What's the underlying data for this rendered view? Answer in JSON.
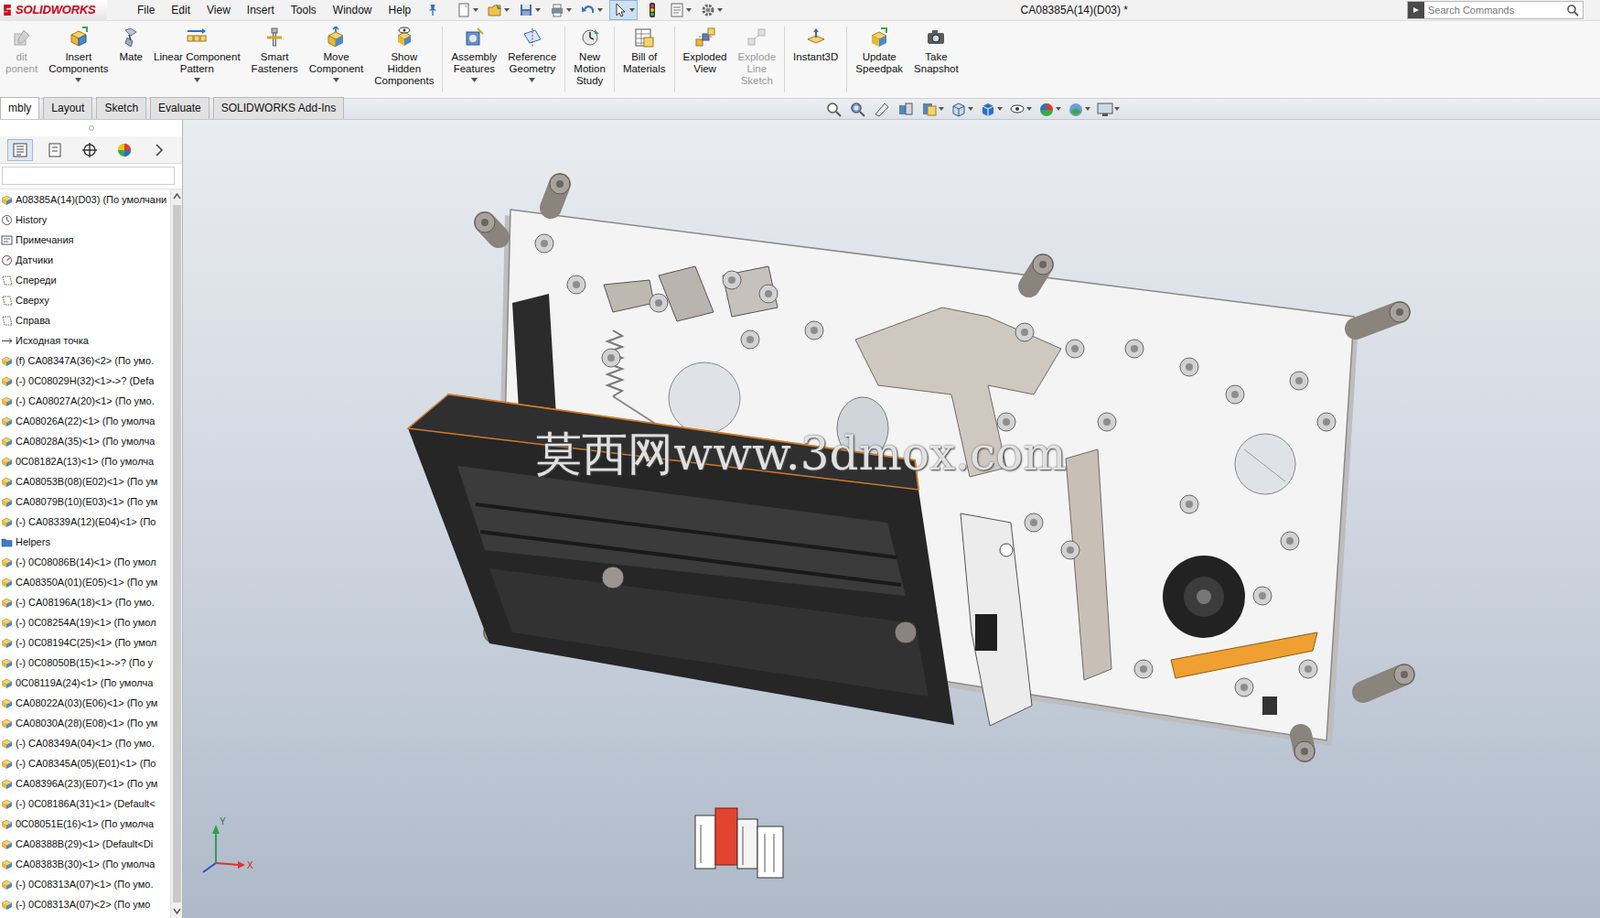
{
  "app": {
    "logo": "SOLIDWORKS",
    "title": "CA08385A(14)(D03) *"
  },
  "menu": [
    "File",
    "Edit",
    "View",
    "Insert",
    "Tools",
    "Window",
    "Help"
  ],
  "search": {
    "placeholder": "Search Commands"
  },
  "ribbon": [
    {
      "buttons": [
        {
          "label": "dit\nponent",
          "disabled": true,
          "dropdown": false
        },
        {
          "label": "Insert\nComponents",
          "disabled": false,
          "dropdown": true
        },
        {
          "label": "Mate",
          "disabled": false,
          "dropdown": false
        },
        {
          "label": "Linear Component\nPattern",
          "disabled": false,
          "dropdown": true
        },
        {
          "label": "Smart\nFasteners",
          "disabled": false,
          "dropdown": false
        },
        {
          "label": "Move\nComponent",
          "disabled": false,
          "dropdown": true
        },
        {
          "label": "Show\nHidden\nComponents",
          "disabled": false,
          "dropdown": false
        }
      ]
    },
    {
      "buttons": [
        {
          "label": "Assembly\nFeatures",
          "disabled": false,
          "dropdown": true
        },
        {
          "label": "Reference\nGeometry",
          "disabled": false,
          "dropdown": true
        }
      ]
    },
    {
      "buttons": [
        {
          "label": "New\nMotion\nStudy",
          "disabled": false,
          "dropdown": false
        }
      ]
    },
    {
      "buttons": [
        {
          "label": "Bill of\nMaterials",
          "disabled": false,
          "dropdown": false
        }
      ]
    },
    {
      "buttons": [
        {
          "label": "Exploded\nView",
          "disabled": false,
          "dropdown": false
        },
        {
          "label": "Explode\nLine\nSketch",
          "disabled": true,
          "dropdown": false
        }
      ]
    },
    {
      "buttons": [
        {
          "label": "Instant3D",
          "disabled": false,
          "dropdown": false
        }
      ]
    },
    {
      "buttons": [
        {
          "label": "Update\nSpeedpak",
          "disabled": false,
          "dropdown": false
        },
        {
          "label": "Take\nSnapshot",
          "disabled": false,
          "dropdown": false
        }
      ]
    }
  ],
  "ribbon_tabs": [
    {
      "label": "mbly",
      "selected": true
    },
    {
      "label": "Layout",
      "selected": false
    },
    {
      "label": "Sketch",
      "selected": false
    },
    {
      "label": "Evaluate",
      "selected": false
    },
    {
      "label": "SOLIDWORKS Add-Ins",
      "selected": false
    }
  ],
  "tree": {
    "items": [
      {
        "label": "A08385A(14)(D03) (По умолчани",
        "kind": "root"
      },
      {
        "label": "History",
        "kind": "history"
      },
      {
        "label": "Примечания",
        "kind": "annotations"
      },
      {
        "label": "Датчики",
        "kind": "sensors"
      },
      {
        "label": "Спереди",
        "kind": "plane"
      },
      {
        "label": "Сверху",
        "kind": "plane"
      },
      {
        "label": "Справа",
        "kind": "plane"
      },
      {
        "label": "Исходная точка",
        "kind": "origin"
      },
      {
        "label": "(f) CA08347A(36)<2> (По умо.",
        "kind": "component"
      },
      {
        "label": "(-) 0C08029H(32)<1>->? (Defa",
        "kind": "component"
      },
      {
        "label": "(-) CA08027A(20)<1> (По умо.",
        "kind": "component"
      },
      {
        "label": "CA08026A(22)<1> (По умолча",
        "kind": "component"
      },
      {
        "label": "CA08028A(35)<1> (По умолча",
        "kind": "component"
      },
      {
        "label": "0C08182A(13)<1> (По умолча",
        "kind": "component"
      },
      {
        "label": "CA08053B(08)(E02)<1> (По ум",
        "kind": "component"
      },
      {
        "label": "CA08079B(10)(E03)<1> (По ум",
        "kind": "component"
      },
      {
        "label": "(-) CA08339A(12)(E04)<1> (По",
        "kind": "component"
      },
      {
        "label": "Helpers",
        "kind": "folder"
      },
      {
        "label": "(-) 0C08086B(14)<1> (По умол",
        "kind": "component"
      },
      {
        "label": "CA08350A(01)(E05)<1> (По ум",
        "kind": "component"
      },
      {
        "label": "(-) CA08196A(18)<1> (По умо.",
        "kind": "component"
      },
      {
        "label": "(-) 0C08254A(19)<1> (По умол",
        "kind": "component"
      },
      {
        "label": "(-) 0C08194C(25)<1> (По умол",
        "kind": "component"
      },
      {
        "label": "(-) 0C08050B(15)<1>->? (По у",
        "kind": "component"
      },
      {
        "label": "0C08119A(24)<1> (По умолча",
        "kind": "component"
      },
      {
        "label": "CA08022A(03)(E06)<1> (По ум",
        "kind": "component"
      },
      {
        "label": "CA08030A(28)(E08)<1> (По ум",
        "kind": "component"
      },
      {
        "label": "(-) CA08349A(04)<1> (По умо.",
        "kind": "component"
      },
      {
        "label": "(-) CA08345A(05)(E01)<1> (По",
        "kind": "component"
      },
      {
        "label": "CA08396A(23)(E07)<1> (По ум",
        "kind": "component"
      },
      {
        "label": "(-) 0C08186A(31)<1> (Default<",
        "kind": "component"
      },
      {
        "label": "0C08051E(16)<1> (По умолча",
        "kind": "component"
      },
      {
        "label": "CA08388B(29)<1> (Default<Di",
        "kind": "component"
      },
      {
        "label": "CA08383B(30)<1> (По умолча",
        "kind": "component"
      },
      {
        "label": "(-) 0C08313A(07)<1> (По умо.",
        "kind": "component"
      },
      {
        "label": "(-) 0C08313A(07)<2> (По умо",
        "kind": "component"
      }
    ]
  },
  "viewport": {
    "watermark": "莫西网www.3dmox.com",
    "triad": {
      "x": "X",
      "y": "Y"
    }
  }
}
